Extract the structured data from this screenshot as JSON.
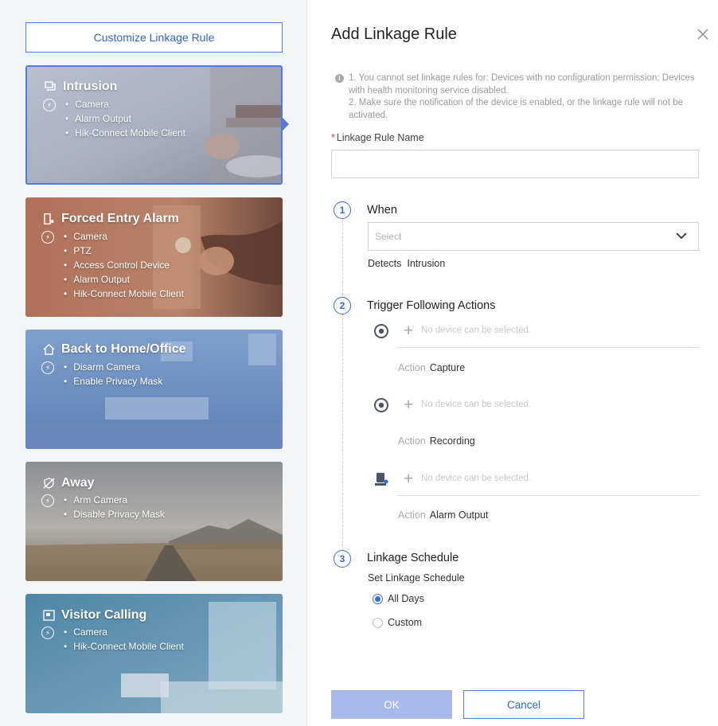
{
  "left": {
    "customize_label": "Customize Linkage Rule",
    "cards": [
      {
        "title": "Intrusion",
        "items": [
          "Camera",
          "Alarm Output",
          "Hik-Connect Mobile Client"
        ],
        "selected": true
      },
      {
        "title": "Forced Entry Alarm",
        "items": [
          "Camera",
          "PTZ",
          "Access Control Device",
          "Alarm Output",
          "Hik-Connect Mobile Client"
        ]
      },
      {
        "title": "Back to Home/Office",
        "items": [
          "Disarm Camera",
          "Enable Privacy Mask"
        ]
      },
      {
        "title": "Away",
        "items": [
          "Arm Camera",
          "Disable Privacy Mask"
        ]
      },
      {
        "title": "Visitor Calling",
        "items": [
          "Camera",
          "Hik-Connect Mobile Client"
        ]
      }
    ]
  },
  "dialog": {
    "title": "Add Linkage Rule",
    "notice": {
      "line1": "1. You cannot set linkage rules for: Devices with no configuration permission; Devices with health monitoring service disabled.",
      "line2": "2. Make sure the notification of the device is enabled, or the linkage rule will not be activated."
    },
    "rule_name_label": "Linkage Rule Name",
    "rule_name_value": "",
    "steps": {
      "when": {
        "number": "1",
        "title": "When",
        "select_placeholder": "Select",
        "detects_key": "Detects",
        "detects_value": "Intrusion"
      },
      "actions": {
        "number": "2",
        "title": "Trigger Following Actions",
        "device_placeholder": "No device can be selected.",
        "action_key": "Action",
        "rows": [
          {
            "icon": "camera-icon",
            "action": "Capture"
          },
          {
            "icon": "camera-icon",
            "action": "Recording"
          },
          {
            "icon": "alarm-output-icon",
            "action": "Alarm Output"
          }
        ]
      },
      "schedule": {
        "number": "3",
        "title": "Linkage Schedule",
        "sub_label": "Set Linkage Schedule",
        "options": [
          {
            "label": "All Days",
            "checked": true
          },
          {
            "label": "Custom",
            "checked": false
          }
        ]
      }
    },
    "ok_label": "OK",
    "cancel_label": "Cancel"
  },
  "colors": {
    "accent": "#2f6fe0",
    "ok_disabled": "#a6b9ea",
    "required": "#e23b3b"
  }
}
